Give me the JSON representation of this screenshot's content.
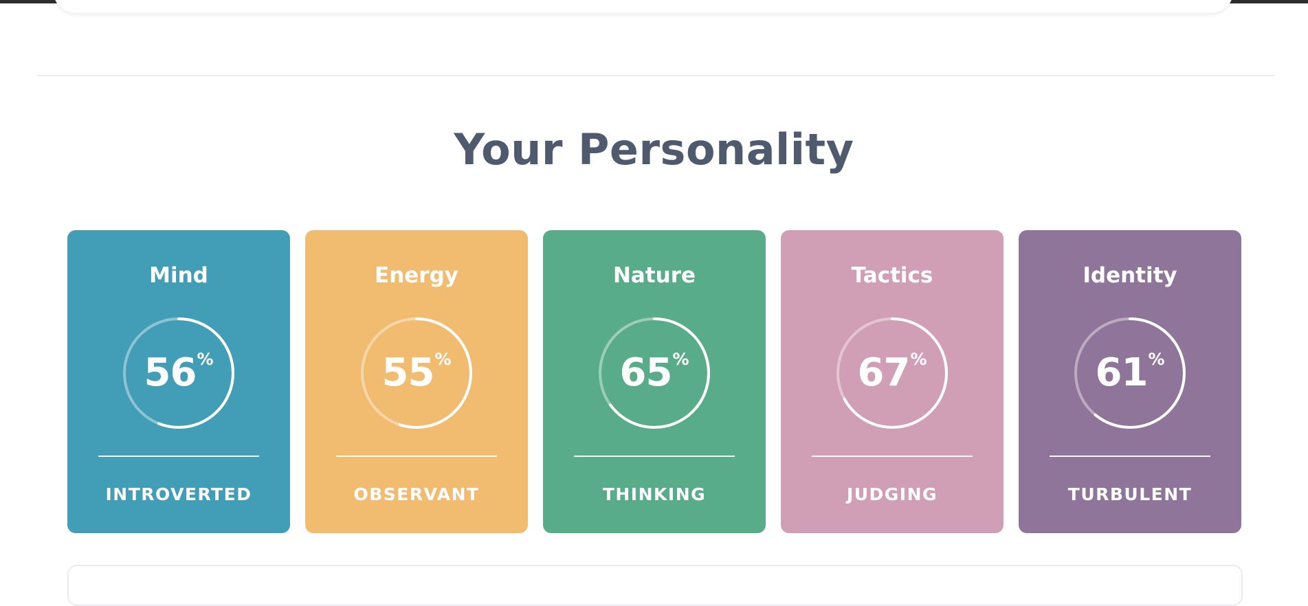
{
  "section": {
    "title": "Your Personality"
  },
  "cards": [
    {
      "title": "Mind",
      "percent": 56,
      "percent_sign": "%",
      "trait": "INTROVERTED",
      "color": "#429db6"
    },
    {
      "title": "Energy",
      "percent": 55,
      "percent_sign": "%",
      "trait": "OBSERVANT",
      "color": "#f1bc70"
    },
    {
      "title": "Nature",
      "percent": 65,
      "percent_sign": "%",
      "trait": "THINKING",
      "color": "#59ac8a"
    },
    {
      "title": "Tactics",
      "percent": 67,
      "percent_sign": "%",
      "trait": "JUDGING",
      "color": "#d19fb5"
    },
    {
      "title": "Identity",
      "percent": 61,
      "percent_sign": "%",
      "trait": "TURBULENT",
      "color": "#8e7599"
    }
  ]
}
